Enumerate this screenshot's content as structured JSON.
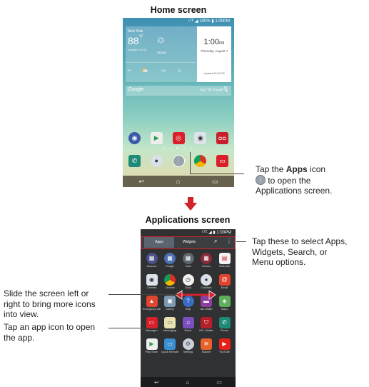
{
  "home": {
    "title": "Home screen",
    "status": "ᴸᵀᴱ ◢ 100% ▮ 1:00PM",
    "weather": {
      "city": "New York",
      "temp": "88",
      "unit": "°F",
      "sub": "Updated 12:00",
      "condition": "Sunny",
      "day1": "Fri",
      "day2": "Sat"
    },
    "clock": {
      "time": "1:00",
      "ampm": "PM",
      "date": "Thursday, August 7",
      "updated": "Updated 12:40 PM"
    },
    "google": {
      "logo": "Google",
      "say": "Say \"Ok Google\""
    },
    "page_dots": "• • ● • •"
  },
  "callout_apps": {
    "line1_pre": "Tap the ",
    "line1_bold": "Apps",
    "line1_post": " icon",
    "line2": " to open the",
    "line3": "Applications screen."
  },
  "apps_screen": {
    "title": "Applications screen",
    "status": "ᴸᵀᴱ ◢ ▮ 1:00PM",
    "tabs": [
      "Apps",
      "Widgets"
    ],
    "rows": [
      [
        "Amazon",
        "Google",
        "Tools",
        "Verizon",
        "Calendar"
      ],
      [
        "Camera",
        "Chrome",
        "Clock",
        "Contacts",
        "Email"
      ],
      [
        "Emergency Alerts",
        "Gallery",
        "Help",
        "Isis Wallet",
        "Maps"
      ],
      [
        "Message+",
        "Messaging",
        "Music",
        "NFL Mobile",
        "Phone"
      ],
      [
        "Play Store",
        "Quick Remote",
        "Settings",
        "Slacker",
        "YouTube"
      ]
    ]
  },
  "callout_tabs": {
    "line1": "Tap these to select Apps,",
    "line2": "Widgets, Search, or",
    "line3": "Menu options."
  },
  "callout_slide": {
    "line1": "Slide the screen left or",
    "line2": "right to bring more icons",
    "line3": "into view."
  },
  "callout_tap": {
    "line1": "Tap an app icon to open",
    "line2": "the app."
  },
  "colors": {
    "accent_red": "#d2232a"
  }
}
